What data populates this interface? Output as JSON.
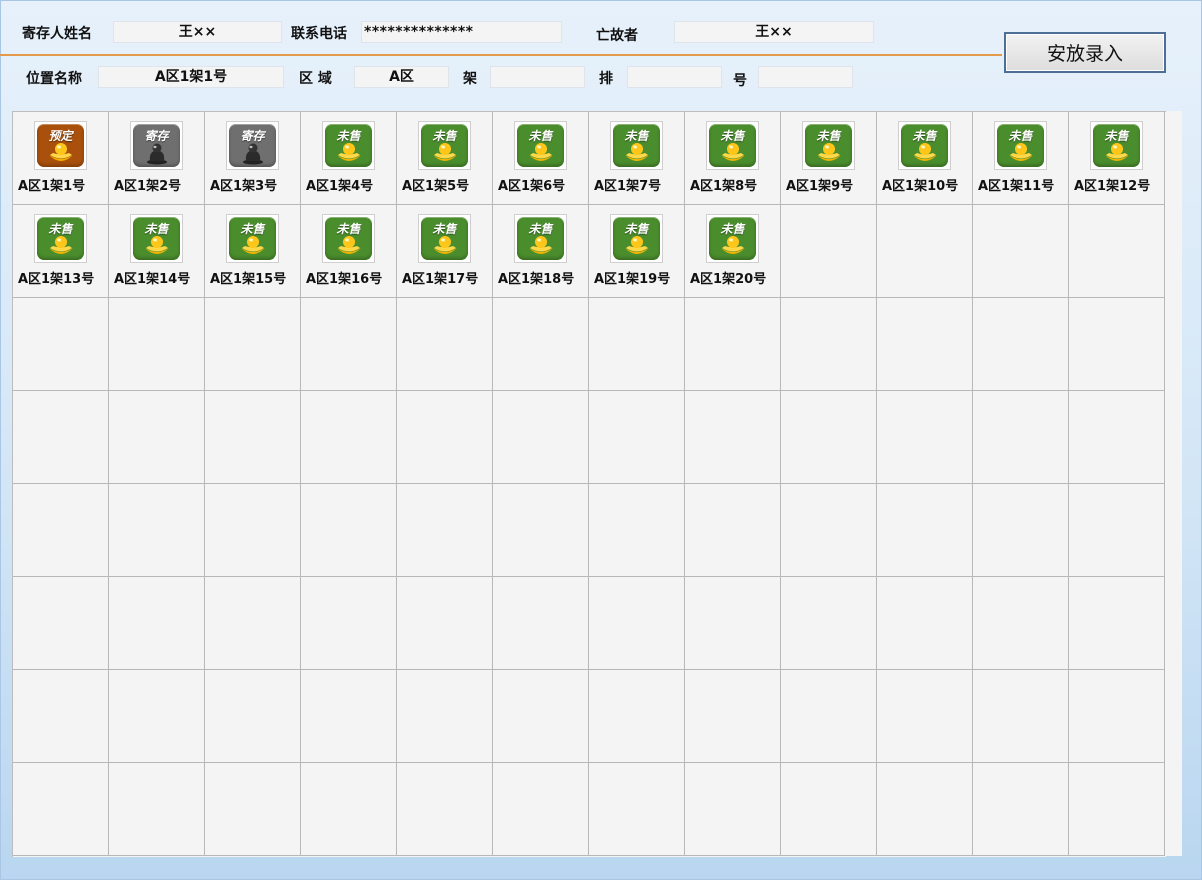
{
  "header": {
    "depositor_label": "寄存人姓名",
    "depositor_value": "王××",
    "phone_label": "联系电话",
    "phone_value": "**************",
    "deceased_label": "亡故者",
    "deceased_value": "王××",
    "location_label": "位置名称",
    "location_value": "A区1架1号",
    "area_label": "区 域",
    "area_value": "A区",
    "shelf_label": "架",
    "shelf_value": "",
    "row_label": "排",
    "row_value": "",
    "number_label": "号",
    "number_value": ""
  },
  "actions": {
    "place_button_label": "安放录入"
  },
  "status_colors": {
    "预定": "#a8500c",
    "寄存": "#6f6f6f",
    "未售": "#4a8d2d"
  },
  "grid": {
    "columns": 12,
    "rows": 8,
    "slots": [
      {
        "label": "A区1架1号",
        "status": "预定",
        "icon": "gold-ingot-icon"
      },
      {
        "label": "A区1架2号",
        "status": "寄存",
        "icon": "urn-icon"
      },
      {
        "label": "A区1架3号",
        "status": "寄存",
        "icon": "urn-icon"
      },
      {
        "label": "A区1架4号",
        "status": "未售",
        "icon": "gold-ingot-icon"
      },
      {
        "label": "A区1架5号",
        "status": "未售",
        "icon": "gold-ingot-icon"
      },
      {
        "label": "A区1架6号",
        "status": "未售",
        "icon": "gold-ingot-icon"
      },
      {
        "label": "A区1架7号",
        "status": "未售",
        "icon": "gold-ingot-icon"
      },
      {
        "label": "A区1架8号",
        "status": "未售",
        "icon": "gold-ingot-icon"
      },
      {
        "label": "A区1架9号",
        "status": "未售",
        "icon": "gold-ingot-icon"
      },
      {
        "label": "A区1架10号",
        "status": "未售",
        "icon": "gold-ingot-icon"
      },
      {
        "label": "A区1架11号",
        "status": "未售",
        "icon": "gold-ingot-icon"
      },
      {
        "label": "A区1架12号",
        "status": "未售",
        "icon": "gold-ingot-icon"
      },
      {
        "label": "A区1架13号",
        "status": "未售",
        "icon": "gold-ingot-icon"
      },
      {
        "label": "A区1架14号",
        "status": "未售",
        "icon": "gold-ingot-icon"
      },
      {
        "label": "A区1架15号",
        "status": "未售",
        "icon": "gold-ingot-icon"
      },
      {
        "label": "A区1架16号",
        "status": "未售",
        "icon": "gold-ingot-icon"
      },
      {
        "label": "A区1架17号",
        "status": "未售",
        "icon": "gold-ingot-icon"
      },
      {
        "label": "A区1架18号",
        "status": "未售",
        "icon": "gold-ingot-icon"
      },
      {
        "label": "A区1架19号",
        "status": "未售",
        "icon": "gold-ingot-icon"
      },
      {
        "label": "A区1架20号",
        "status": "未售",
        "icon": "gold-ingot-icon"
      }
    ]
  }
}
